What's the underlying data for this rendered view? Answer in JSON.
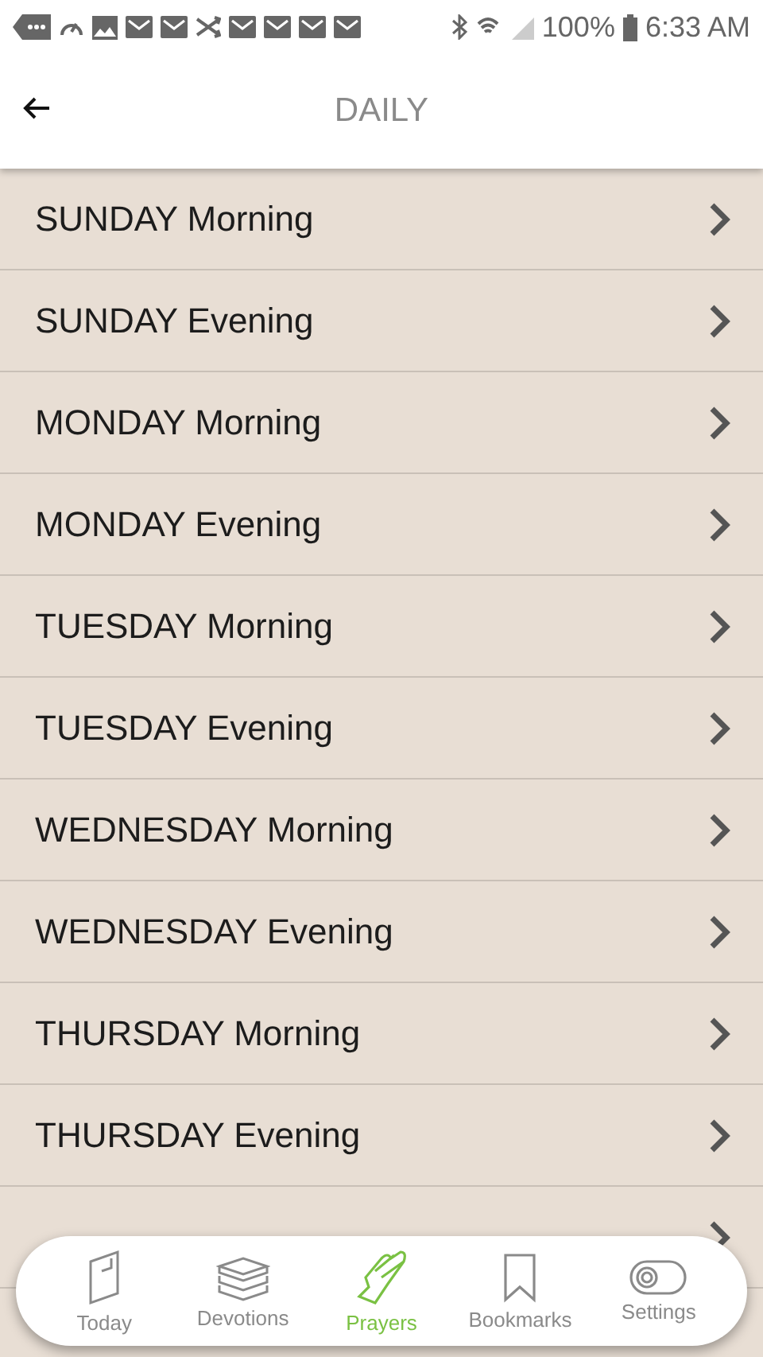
{
  "status_bar": {
    "battery": "100%",
    "time": "6:33 AM"
  },
  "header": {
    "title": "DAILY"
  },
  "items": [
    {
      "label": "SUNDAY Morning"
    },
    {
      "label": "SUNDAY Evening"
    },
    {
      "label": "MONDAY Morning"
    },
    {
      "label": "MONDAY Evening"
    },
    {
      "label": "TUESDAY Morning"
    },
    {
      "label": "TUESDAY Evening"
    },
    {
      "label": "WEDNESDAY Morning"
    },
    {
      "label": "WEDNESDAY Evening"
    },
    {
      "label": "THURSDAY Morning"
    },
    {
      "label": "THURSDAY Evening"
    }
  ],
  "nav": [
    {
      "label": "Today",
      "kind": "book",
      "selected": false
    },
    {
      "label": "Devotions",
      "kind": "stack",
      "selected": false
    },
    {
      "label": "Prayers",
      "kind": "hands",
      "selected": true
    },
    {
      "label": "Bookmarks",
      "kind": "bookmark",
      "selected": false
    },
    {
      "label": "Settings",
      "kind": "toggle",
      "selected": false
    }
  ]
}
